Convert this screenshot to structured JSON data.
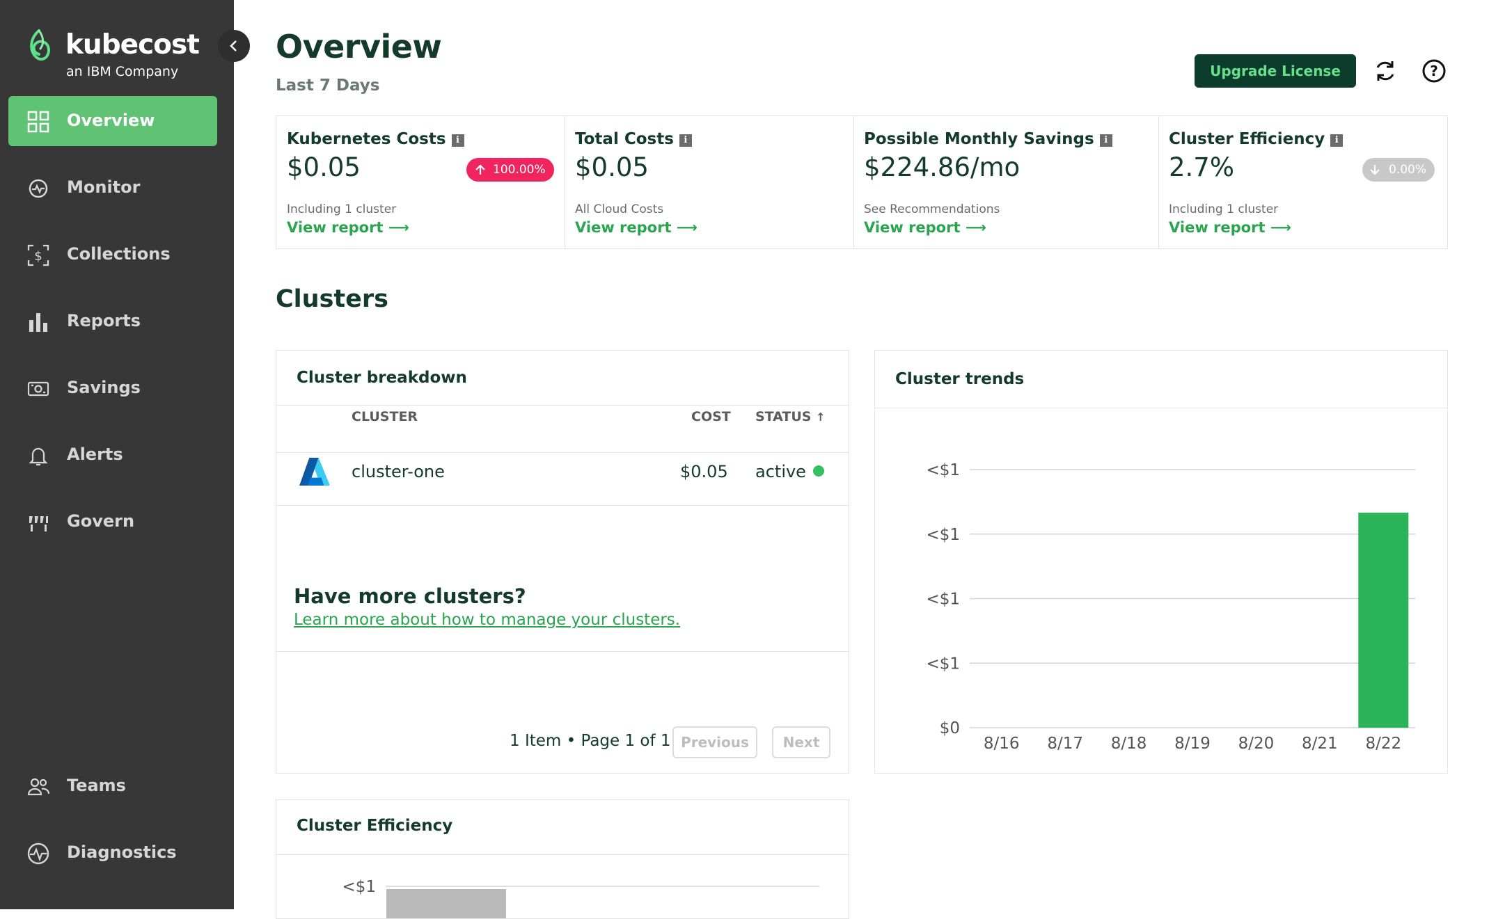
{
  "brand": {
    "name": "kubecost",
    "tagline": "an IBM Company"
  },
  "sidebar": {
    "items": [
      {
        "label": "Overview",
        "icon": "grid-icon",
        "active": true
      },
      {
        "label": "Monitor",
        "icon": "monitor-pulse-icon"
      },
      {
        "label": "Collections",
        "icon": "dollar-frame-icon"
      },
      {
        "label": "Reports",
        "icon": "bar-chart-icon"
      },
      {
        "label": "Savings",
        "icon": "money-bill-icon"
      },
      {
        "label": "Alerts",
        "icon": "bell-icon"
      },
      {
        "label": "Govern",
        "icon": "govern-icon"
      },
      {
        "label": "Teams",
        "icon": "people-icon"
      },
      {
        "label": "Diagnostics",
        "icon": "diagnostics-icon"
      }
    ]
  },
  "header": {
    "title": "Overview",
    "subtitle": "Last 7 Days",
    "upgrade_label": "Upgrade License",
    "refresh_icon": "refresh-icon",
    "help_icon": "help-icon"
  },
  "metrics": [
    {
      "title": "Kubernetes Costs",
      "value": "$0.05",
      "badge": "100.00%",
      "badge_direction": "up",
      "desc": "Including 1 cluster",
      "link": "View report"
    },
    {
      "title": "Total Costs",
      "value": "$0.05",
      "desc": "All Cloud Costs",
      "link": "View report"
    },
    {
      "title": "Possible Monthly Savings",
      "value": "$224.86/mo",
      "desc": "See Recommendations",
      "link": "View report"
    },
    {
      "title": "Cluster Efficiency",
      "value": "2.7%",
      "badge": "0.00%",
      "badge_direction": "down",
      "desc": "Including 1 cluster",
      "link": "View report"
    }
  ],
  "clusters_section_title": "Clusters",
  "breakdown": {
    "title": "Cluster breakdown",
    "columns": {
      "cluster": "CLUSTER",
      "cost": "COST",
      "status": "STATUS"
    },
    "rows": [
      {
        "cluster": "cluster-one",
        "cost": "$0.05",
        "status": "active",
        "provider_icon": "azure-logo-icon"
      }
    ],
    "promo_title": "Have more clusters?",
    "promo_link": "Learn more about how to manage your clusters.",
    "pager_text": "1 Item • Page 1 of 1",
    "prev_label": "Previous",
    "next_label": "Next"
  },
  "trends": {
    "title": "Cluster trends"
  },
  "efficiency": {
    "title": "Cluster Efficiency"
  },
  "colors": {
    "accent": "#5fc373",
    "bar": "#2bb35a",
    "dark": "#133a2a",
    "upgrade_bg": "#0b3c2c"
  },
  "chart_data": [
    {
      "type": "bar",
      "title": "Cluster trends",
      "categories": [
        "8/16",
        "8/17",
        "8/18",
        "8/19",
        "8/20",
        "8/21",
        "8/22"
      ],
      "values": [
        0,
        0,
        0,
        0,
        0,
        0,
        0.05
      ],
      "ytick_labels": [
        "$0",
        "<$1",
        "<$1",
        "<$1",
        "<$1"
      ],
      "ylim": [
        0,
        0.06
      ],
      "grid": true
    },
    {
      "type": "bar",
      "title": "Cluster Efficiency",
      "ytick_labels": [
        "<$1"
      ],
      "series": [
        {
          "values": [
            0.05
          ]
        }
      ]
    }
  ]
}
